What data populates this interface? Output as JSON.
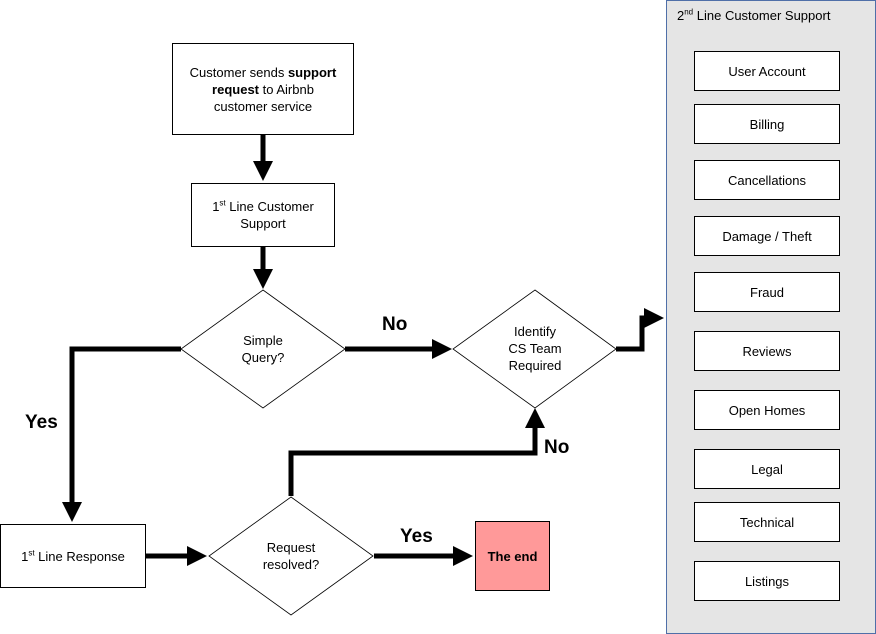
{
  "nodes": {
    "start": {
      "text_pre": "Customer sends ",
      "text_bold_1": "support",
      "text_bold_2": "request",
      "text_post_1": " to Airbnb",
      "text_post_2": "customer service"
    },
    "first_line": {
      "num": "1",
      "sup": "st",
      "line1_rest": " Line Customer",
      "line2": "Support"
    },
    "simple_query": {
      "line1": "Simple",
      "line2": "Query?"
    },
    "identify_team": {
      "line1": "Identify",
      "line2": "CS Team",
      "line3": "Required"
    },
    "first_response": {
      "num": "1",
      "sup": "st",
      "rest": " Line Response"
    },
    "request_resolved": {
      "line1": "Request",
      "line2": "resolved?"
    },
    "the_end": {
      "text": "The end",
      "color": "#ff9999"
    }
  },
  "edge_labels": {
    "no_1": "No",
    "yes_1": "Yes",
    "no_2": "No",
    "yes_2": "Yes"
  },
  "second_line": {
    "title_num": "2",
    "title_sup": "nd",
    "title_rest": " Line Customer Support",
    "teams": [
      "User Account",
      "Billing",
      "Cancellations",
      "Damage / Theft",
      "Fraud",
      "Reviews",
      "Open Homes",
      "Legal",
      "Technical",
      "Listings"
    ]
  }
}
